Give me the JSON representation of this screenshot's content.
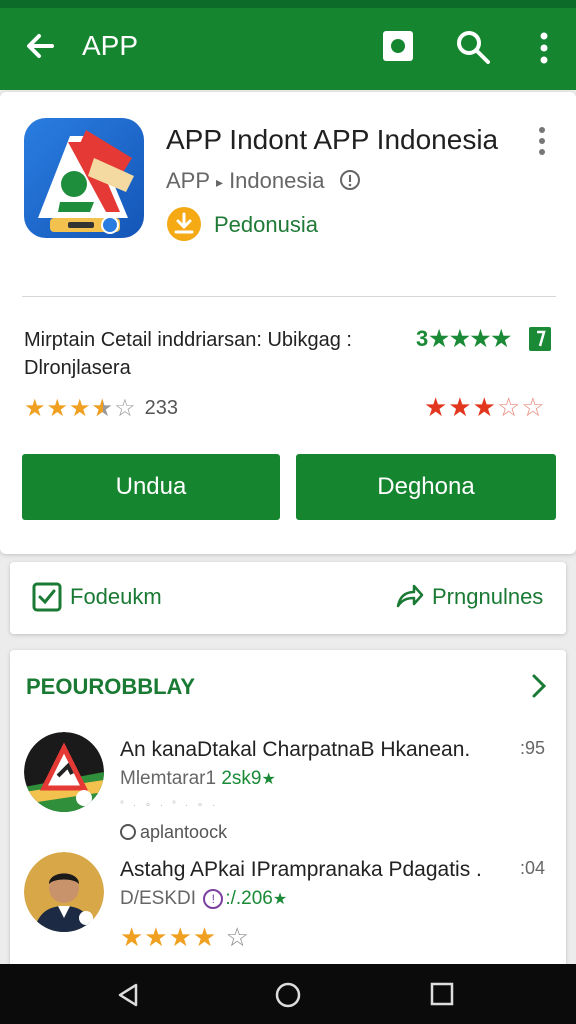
{
  "appbar": {
    "title": "APP",
    "icons": [
      "back-arrow-icon",
      "shield-icon",
      "search-icon",
      "more-vert-icon"
    ]
  },
  "app": {
    "name": "APP Indont APP Indonesia",
    "developer": "APP",
    "developer_sep": "▸",
    "developer_region": "Indonesia",
    "download_label": "Pedonusia",
    "description": "Mirptain Cetail inddriarsan: Ubikgag :\nDlronjlasera",
    "green_rating": "3★★★★",
    "user_rating": {
      "filled": 3.5,
      "total": 5,
      "count": "233"
    },
    "red_rating": {
      "filled": 3,
      "total": 5
    },
    "colors": {
      "accent": "#16852f",
      "red": "#e2371f",
      "gold": "#f0a020"
    }
  },
  "buttons": {
    "primary": "Undua",
    "secondary": "Deghona"
  },
  "actions": {
    "left": "Fodeukm",
    "right": "Prngnulnes"
  },
  "section": {
    "title": "PEOUROBBLAY",
    "items": [
      {
        "title": "An kanaDtakal CharpatnaB Hkanean.",
        "num": ":95",
        "sub_prefix": "Mlemtarar1",
        "sub_green": "2sk9",
        "dots": "° · ∘ · ° · ∘ ·",
        "meta": "aplantoock"
      },
      {
        "title": "Astahg APkai IPrampranaka Pdagatis .",
        "num": ":04",
        "sub_prefix": "D/ESKDI",
        "sub_circ": "!",
        "sub_green": ":/.206",
        "rating": {
          "filled": 4,
          "total": 5
        }
      }
    ]
  }
}
